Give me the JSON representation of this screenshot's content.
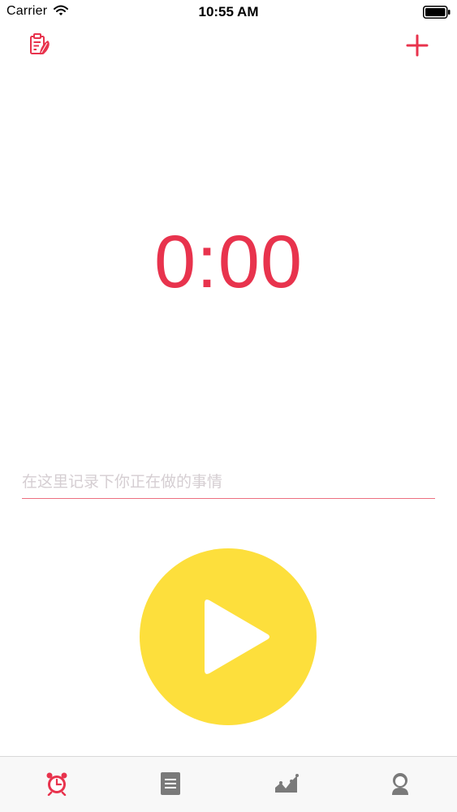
{
  "status_bar": {
    "carrier": "Carrier",
    "time": "10:55 AM",
    "icons": [
      "wifi-icon",
      "battery-icon"
    ]
  },
  "nav": {
    "left_icon": "clipboard-edit-icon",
    "right_icon": "plus-icon"
  },
  "timer": {
    "display": "0:00"
  },
  "task": {
    "value": "",
    "placeholder": "在这里记录下你正在做的事情"
  },
  "play": {
    "icon": "play-icon"
  },
  "tabs": [
    {
      "icon": "alarm-clock-icon",
      "active": true
    },
    {
      "icon": "document-icon",
      "active": false
    },
    {
      "icon": "chart-icon",
      "active": false
    },
    {
      "icon": "user-icon",
      "active": false
    }
  ],
  "colors": {
    "accent": "#e8334d",
    "play_button": "#fddf3c",
    "placeholder": "#d5ced2",
    "tab_inactive": "#7a7a7a",
    "tab_bar_bg": "#f8f8f8"
  }
}
